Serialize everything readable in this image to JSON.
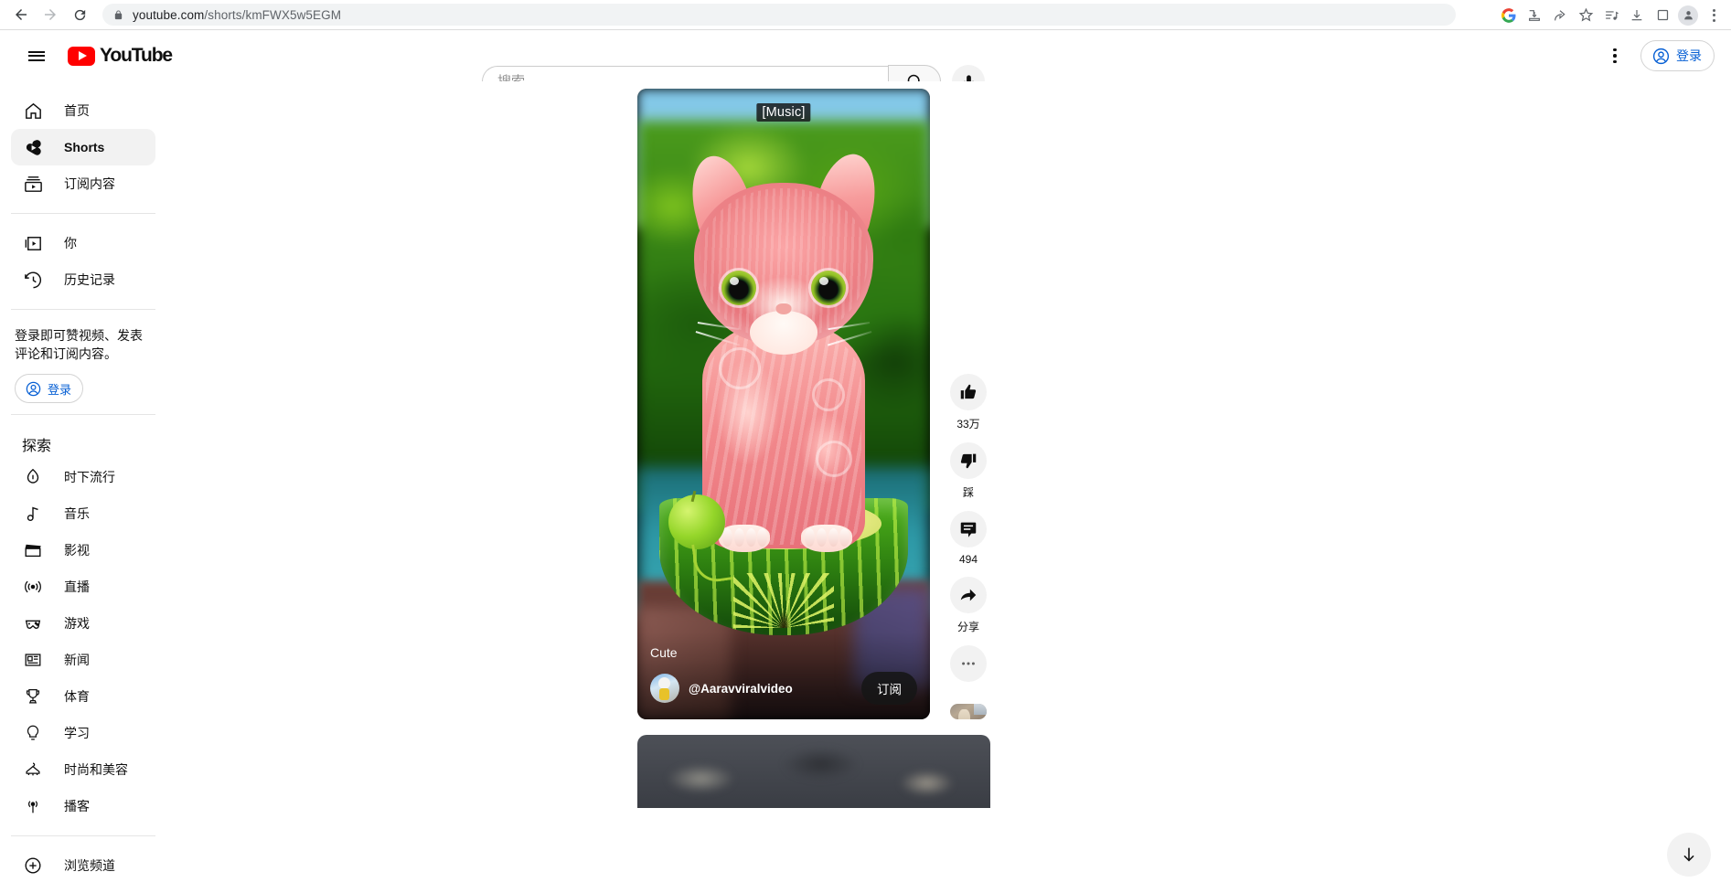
{
  "browser": {
    "url_main": "youtube.com",
    "url_path": "/shorts/kmFWX5w5EGM",
    "back_icon": "back-arrow-icon",
    "forward_icon": "forward-arrow-icon",
    "reload_icon": "reload-icon",
    "lock_icon": "lock-icon",
    "toolbar_icons": [
      "google-icon",
      "install-app-icon",
      "share-icon",
      "bookmark-star-icon",
      "playlist-queue-icon",
      "downloads-icon",
      "split-screen-icon",
      "profile-avatar-icon",
      "chrome-menu-icon"
    ]
  },
  "header": {
    "menu_icon": "hamburger-menu-icon",
    "logo_text": "YouTube",
    "search_placeholder": "搜索",
    "search_value": "",
    "search_icon": "search-icon",
    "mic_icon": "microphone-icon",
    "settings_icon": "more-vertical-icon",
    "signin_label": "登录",
    "signin_icon": "account-circle-icon"
  },
  "sidebar": {
    "primary": [
      {
        "label": "首页",
        "icon": "home-icon",
        "active": false
      },
      {
        "label": "Shorts",
        "icon": "shorts-icon",
        "active": true
      },
      {
        "label": "订阅内容",
        "icon": "subscriptions-icon",
        "active": false
      }
    ],
    "secondary": [
      {
        "label": "你",
        "icon": "you-library-icon"
      },
      {
        "label": "历史记录",
        "icon": "history-clock-icon"
      }
    ],
    "signin_prompt": "登录即可赞视频、发表评论和订阅内容。",
    "signin_label": "登录",
    "signin_icon": "account-circle-icon",
    "explore_title": "探索",
    "explore": [
      {
        "label": "时下流行",
        "icon": "trending-flame-icon"
      },
      {
        "label": "音乐",
        "icon": "music-note-icon"
      },
      {
        "label": "影视",
        "icon": "film-clapper-icon"
      },
      {
        "label": "直播",
        "icon": "live-broadcast-icon"
      },
      {
        "label": "游戏",
        "icon": "gaming-controller-icon"
      },
      {
        "label": "新闻",
        "icon": "news-paper-icon"
      },
      {
        "label": "体育",
        "icon": "sports-trophy-icon"
      },
      {
        "label": "学习",
        "icon": "learning-bulb-icon"
      },
      {
        "label": "时尚和美容",
        "icon": "fashion-hanger-icon"
      },
      {
        "label": "播客",
        "icon": "podcast-icon"
      }
    ],
    "browse": [
      {
        "label": "浏览频道",
        "icon": "plus-circle-icon"
      }
    ]
  },
  "player": {
    "caption": "[Music]",
    "video_title": "Cute",
    "channel_name": "@Aaravviralvideo",
    "channel_avatar": "channel-avatar",
    "subscribe_label": "订阅"
  },
  "actions": [
    {
      "name": "like",
      "icon": "thumbs-up-icon",
      "label": "33万"
    },
    {
      "name": "dislike",
      "icon": "thumbs-down-icon",
      "label": "踩"
    },
    {
      "name": "comments",
      "icon": "comment-bubble-icon",
      "label": "494"
    },
    {
      "name": "share",
      "icon": "share-arrow-icon",
      "label": "分享"
    },
    {
      "name": "more",
      "icon": "more-horizontal-icon",
      "label": ""
    }
  ],
  "nav": {
    "next_thumb": "next-video-thumbnail",
    "scroll_down_icon": "arrow-down-icon"
  }
}
